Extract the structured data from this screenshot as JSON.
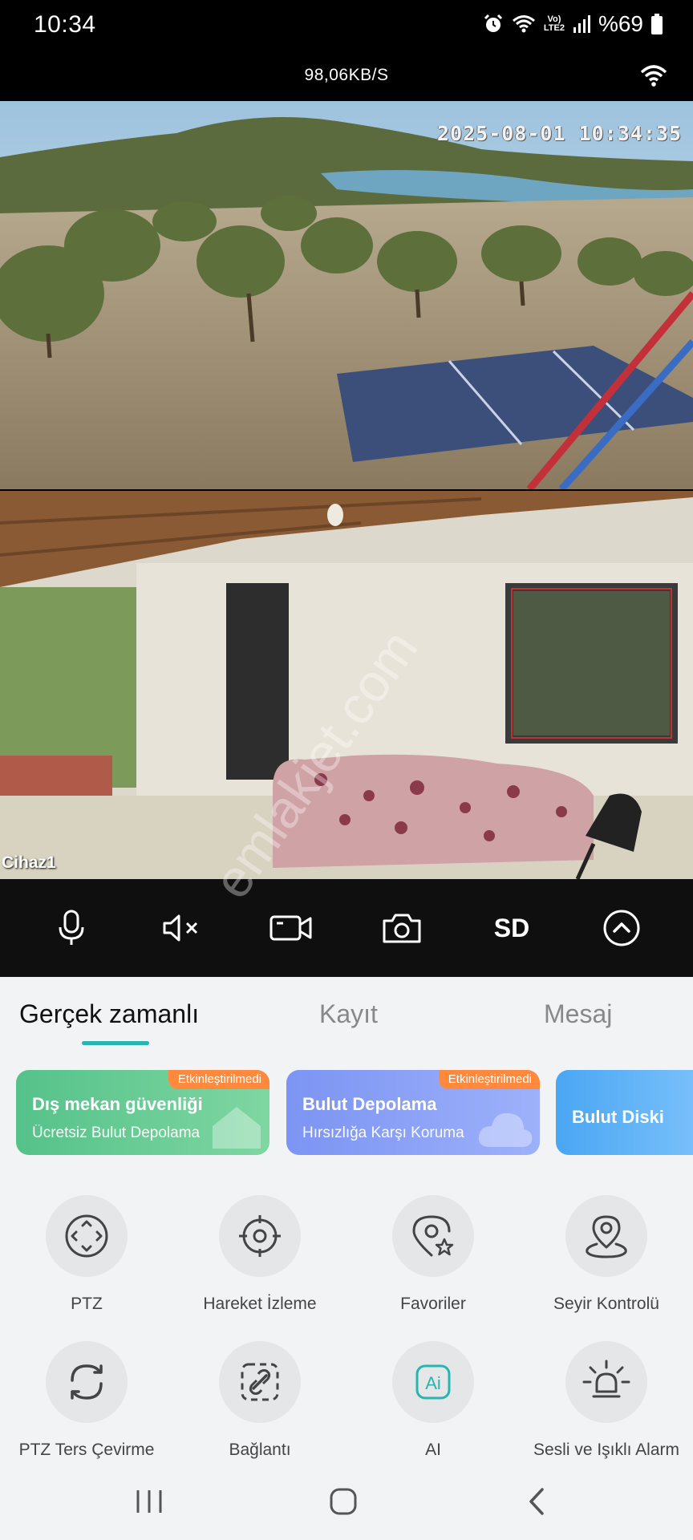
{
  "status_bar": {
    "time": "10:34",
    "network": "Vo) LTE2",
    "battery": "%69"
  },
  "stream": {
    "speed": "98,06KB/S"
  },
  "camera": {
    "timestamp": "2025-08-01 10:34:35",
    "device_label": "Cihaz1",
    "watermark": "emlakjet.com"
  },
  "controls": {
    "sd_label": "SD"
  },
  "tabs": [
    "Gerçek zamanlı",
    "Kayıt",
    "Mesaj"
  ],
  "promo_cards": [
    {
      "badge": "Etkinleştirilmedi",
      "title": "Dış mekan güvenliği",
      "subtitle": "Ücretsiz Bulut Depolama"
    },
    {
      "badge": "Etkinleştirilmedi",
      "title": "Bulut Depolama",
      "subtitle": "Hırsızlığa Karşı Koruma"
    },
    {
      "title": "Bulut Diski"
    }
  ],
  "features": [
    {
      "label": "PTZ",
      "icon": "ptz-icon"
    },
    {
      "label": "Hareket İzleme",
      "icon": "crosshair-icon"
    },
    {
      "label": "Favoriler",
      "icon": "location-star-icon"
    },
    {
      "label": "Seyir Kontrolü",
      "icon": "map-pin-icon"
    },
    {
      "label": "PTZ Ters Çevirme",
      "icon": "rotate-icon"
    },
    {
      "label": "Bağlantı",
      "icon": "link-icon"
    },
    {
      "label": "AI",
      "icon": "ai-icon"
    },
    {
      "label": "Sesli ve Işıklı Alarm",
      "icon": "bulb-alarm-icon"
    }
  ],
  "colors": {
    "accent": "#27b5b0",
    "badge": "#ff8a3d",
    "green_card": "#55c28a",
    "blue_card": "#7c94f3",
    "sky_card": "#4aa6f3"
  }
}
